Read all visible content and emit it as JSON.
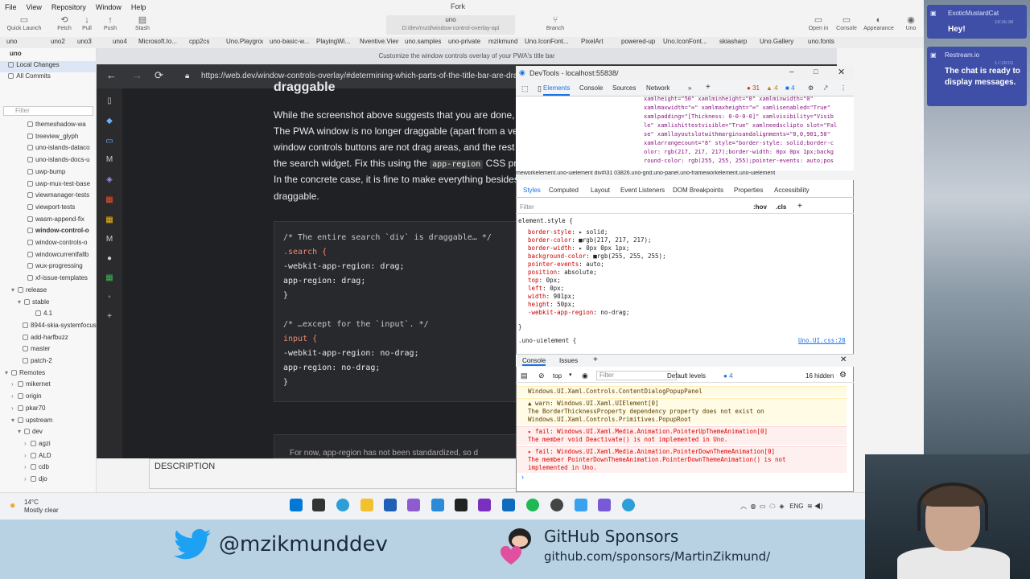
{
  "fork": {
    "menu": [
      "File",
      "View",
      "Repository",
      "Window",
      "Help"
    ],
    "title": "Fork",
    "toolbar": [
      {
        "label": "Quick Launch",
        "icon": "launch-icon"
      },
      {
        "label": "Fetch",
        "icon": "fetch-icon"
      },
      {
        "label": "Pull",
        "icon": "pull-icon"
      },
      {
        "label": "Push",
        "icon": "push-icon"
      },
      {
        "label": "Stash",
        "icon": "stash-icon"
      }
    ],
    "repo_name": "uno",
    "repo_path": "D:/dev/mzd/window-control-overlay-api",
    "branch_label": "Branch",
    "right_toolbar": [
      "Open in",
      "Console",
      "Appearance",
      "Uno"
    ],
    "tabs": [
      "uno",
      "uno2",
      "uno3",
      "uno4",
      "Microsoft.Io...",
      "cpp2cs",
      "Uno.Playgrou...",
      "uno-basic-w...",
      "PlayingWi...",
      "Nventive.View",
      "uno.samples",
      "uno-private",
      "mzikmund",
      "Uno.IconFont...",
      "PixelArt",
      "powered-up",
      "Uno.IconFont...",
      "skiasharp",
      "Uno.Gallery",
      "uno.fonts"
    ],
    "sidebar": {
      "repo": "uno",
      "local_changes": "Local Changes",
      "all_commits": "All Commits",
      "filter_placeholder": "Filter",
      "branches": [
        "themeshadow-wa",
        "treeview_glyph",
        "uno-islands-dataco",
        "uno-islands-docs-u",
        "uwp-bump",
        "uwp-mux-test-base",
        "viewmanager-tests",
        "viewport-tests",
        "wasm-append-fix",
        "window-control-o",
        "window-controls-o",
        "windowcurrentfallb",
        "wux-progressing",
        "xf-issue-templates"
      ],
      "release": "release",
      "stable": "stable",
      "release_items": [
        "4.1",
        "8944-skia-systemfocus",
        "add-harfbuzz",
        "master",
        "patch-2"
      ],
      "remotes": "Remotes",
      "remote_items": [
        "mikernet",
        "origin",
        "pkar70",
        "upstream"
      ],
      "dev": "dev",
      "dev_items": [
        "agzi",
        "ALD",
        "cdb",
        "djo"
      ]
    }
  },
  "browser": {
    "window_title": "Customize the window controls overlay of your PWA's title bar",
    "url": "https://web.dev/window-controls-overlay/#determining-which-parts-of-the-title-bar-are-dragg",
    "heading": "draggable",
    "para1": [
      "While the screenshot above suggests that you are done, y",
      "The PWA window is no longer draggable (apart from a ve",
      "window controls buttons are not drag areas, and the rest",
      "the search widget. Fix this using the",
      "In the concrete case, it is fine to make everything besides",
      "draggable."
    ],
    "para1_code": "app-region",
    "para1_after": "CSS pro",
    "code": [
      "/* The entire search `div` is draggable… */",
      ".search {",
      "  -webkit-app-region: drag;",
      "  app-region: drag;",
      "}",
      "/* …except for the `input`. */",
      "input {",
      "  -webkit-app-region: no-drag;",
      "  app-region: no-drag;",
      "}"
    ],
    "next_para": "For now, app-region has not been standardized, so d"
  },
  "description_label": "DESCRIPTION",
  "devtools": {
    "title": "DevTools - localhost:55838/",
    "tabs": [
      "Elements",
      "Console",
      "Sources",
      "Network"
    ],
    "errors": "31",
    "warnings": "4",
    "info": "4",
    "dom_lines": [
      "xamlheight=\"50\" xamlminheight=\"0\" xamlminwidth=\"0\"",
      "xamlmaxwidth=\"∞\" xamlmaxheight=\"∞\" xamlisenabled=\"True\"",
      "xamlpadding=\"[Thickness: 0-0-0-0]\" xamlvisibility=\"Visib",
      "le\" xamlishittestvisible=\"True\" xamlneedsclipto slot=\"Fal",
      "se\" xamllayoutslotwithmarginsandalignments=\"0,0,901,50\"",
      "xamlarrangecount=\"8\" style=\"border-style: solid;border-c",
      "olor: rgb(217, 217, 217);border-width: 0px 0px 1px;backg",
      "round-color: rgb(255, 255, 255);pointer-events: auto;pos"
    ],
    "breadcrumb": "meworkelement.uno-uielement   div#\\31 03826.uno-grid.uno-panel.uno-frameworkelement.uno-uielement",
    "style_tabs": [
      "Styles",
      "Computed",
      "Layout",
      "Event Listeners",
      "DOM Breakpoints",
      "Properties",
      "Accessibility"
    ],
    "filter_placeholder": "Filter",
    "hov": ":hov",
    "cls": ".cls",
    "selector": "element.style {",
    "css": [
      {
        "p": "border-style",
        "v": "▸ solid;"
      },
      {
        "p": "border-color",
        "v": "■rgb(217, 217, 217);"
      },
      {
        "p": "border-width",
        "v": "▸ 0px 0px 1px;"
      },
      {
        "p": "background-color",
        "v": "■rgb(255, 255, 255);"
      },
      {
        "p": "pointer-events",
        "v": "auto;"
      },
      {
        "p": "position",
        "v": "absolute;"
      },
      {
        "p": "top",
        "v": "0px;"
      },
      {
        "p": "left",
        "v": "0px;"
      },
      {
        "p": "width",
        "v": "901px;"
      },
      {
        "p": "height",
        "v": "50px;"
      },
      {
        "p": "-webkit-app-region",
        "v": "no-drag;"
      }
    ],
    "css_close": "}",
    "next_rule": ".uno-uielement {",
    "next_rule_src": "Uno.UI.css:28",
    "console_tabs": [
      "Console",
      "Issues"
    ],
    "context": "top",
    "console_filter": "Filter",
    "levels": "Default levels",
    "level_count": "4",
    "hidden": "16 hidden",
    "messages": [
      {
        "kind": "warn",
        "lines": [
          "Windows.UI.Xaml.Controls.ContentDialogPopupPanel"
        ]
      },
      {
        "kind": "warn",
        "lines": [
          "▲ warn: Windows.UI.Xaml.UIElement[0]",
          "     The BorderThicknessProperty dependency property does not exist on",
          "Windows.UI.Xaml.Controls.Primitives.PopupRoot"
        ]
      },
      {
        "kind": "err",
        "lines": [
          "▸ fail: Windows.UI.Xaml.Media.Animation.PointerUpThemeAnimation[0]",
          "     The member void Deactivate() is not implemented in Uno."
        ]
      },
      {
        "kind": "err",
        "lines": [
          "▸ fail: Windows.UI.Xaml.Media.Animation.PointerDownThemeAnimation[0]",
          "     The member PointerDownThemeAnimation.PointerDownThemeAnimation() is not",
          "     implemented in Uno."
        ]
      }
    ]
  },
  "chat": [
    {
      "name": "ExoticMustardCat",
      "time": "18:35:38",
      "text": "Hey!"
    },
    {
      "name": "Restream.io",
      "time": "17:29:02",
      "text": "The chat is ready to display messages."
    }
  ],
  "taskbar": {
    "temp": "14°C",
    "weather": "Mostly clear",
    "lang": "ENG"
  },
  "banner": {
    "twitter": "@mzikmunddev",
    "sponsors_title": "GitHub Sponsors",
    "sponsors_url": "github.com/sponsors/MartinZikmund/"
  },
  "colors": {
    "twitter_blue": "#1da1f2",
    "devtools_accent": "#1a73e8",
    "chat_bg": "#3f4fa8"
  }
}
